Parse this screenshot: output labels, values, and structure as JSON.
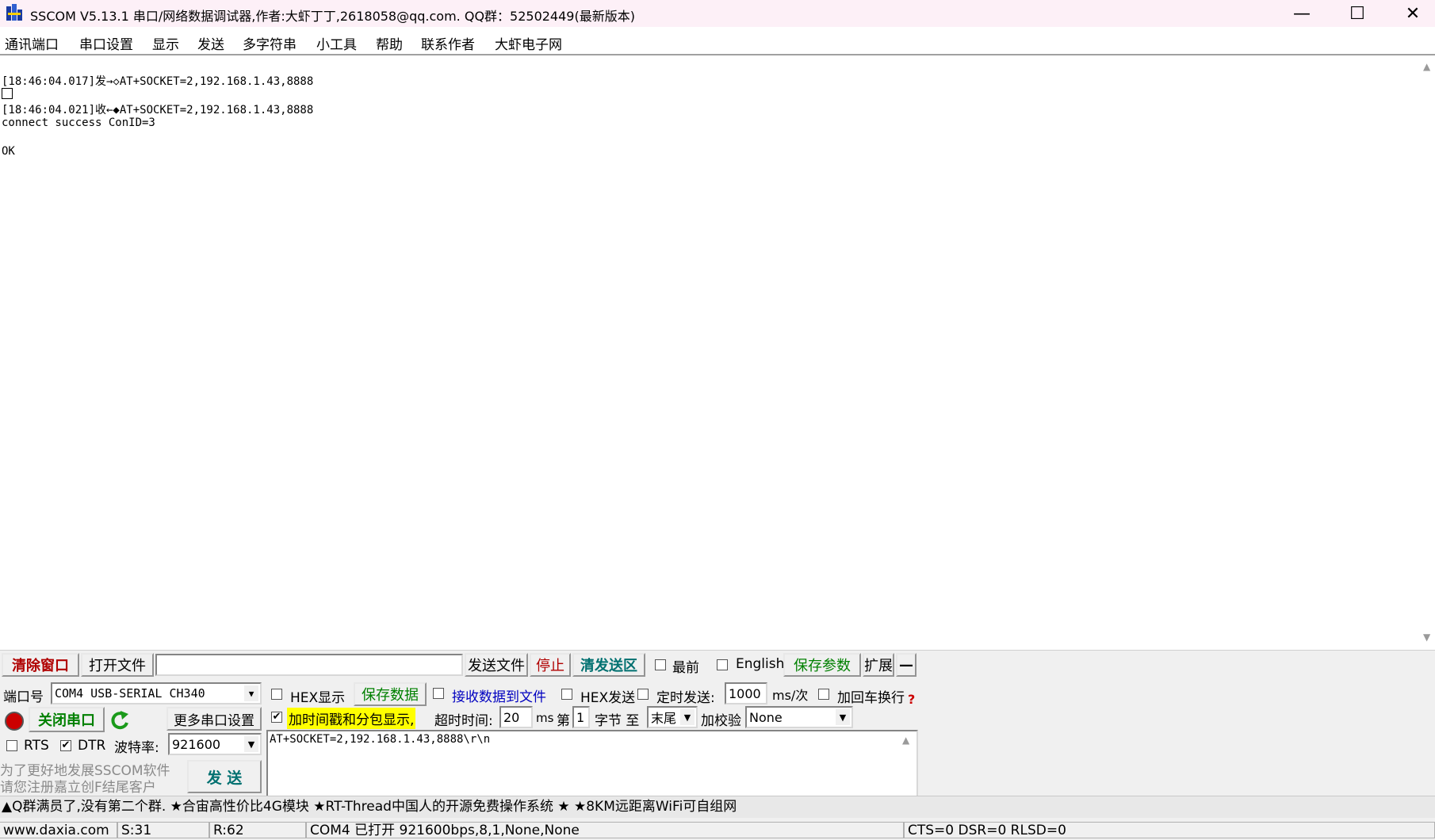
{
  "window": {
    "title": "SSCOM V5.13.1 串口/网络数据调试器,作者:大虾丁丁,2618058@qq.com. QQ群：52502449(最新版本)",
    "minimize": "—",
    "maximize": "☐",
    "close": "✕"
  },
  "menu": [
    "通讯端口",
    "串口设置",
    "显示",
    "发送",
    "多字符串",
    "小工具",
    "帮助",
    "联系作者",
    "大虾电子网"
  ],
  "log": {
    "line1": "[18:46:04.017]发→◇AT+SOCKET=2,192.168.1.43,8888",
    "line2": "[18:46:04.021]收←◆AT+SOCKET=2,192.168.1.43,8888",
    "line3": "connect success ConID=3",
    "line4": "OK"
  },
  "toolbar": {
    "clear_window": "清除窗口",
    "open_file": "打开文件",
    "file_path": "",
    "send_file": "发送文件",
    "stop": "停止",
    "clear_send": "清发送区",
    "topmost": "最前",
    "english": "English",
    "save_params": "保存参数",
    "expand": "扩展",
    "collapse": "—"
  },
  "port": {
    "port_label": "端口号",
    "port_value": "COM4 USB-SERIAL CH340",
    "close_port": "关闭串口",
    "more_settings": "更多串口设置",
    "rts": "RTS",
    "dtr": "DTR",
    "baud_label": "波特率:",
    "baud_value": "921600",
    "promo_line1": "为了更好地发展SSCOM软件",
    "promo_line2": "请您注册嘉立创F结尾客户",
    "send": "发 送"
  },
  "options": {
    "hex_display": "HEX显示",
    "save_data": "保存数据",
    "recv_to_file": "接收数据到文件",
    "hex_send": "HEX发送",
    "timed_send": "定时发送:",
    "interval": "1000",
    "interval_unit": "ms/次",
    "append_crlf": "加回车换行",
    "timestamp": "加时间戳和分包显示,",
    "timeout_label": "超时时间:",
    "timeout_value": "20",
    "timeout_unit": "ms",
    "nth_label": "第",
    "nth_value": "1",
    "byte_to": "字节 至",
    "end_value": "末尾",
    "checksum_label": "加校验",
    "checksum_value": "None",
    "help": "?"
  },
  "send_text": "AT+SOCKET=2,192.168.1.43,8888\\r\\n",
  "marquee": "▲Q群满员了,没有第二个群. ★合宙高性价比4G模块 ★RT-Thread中国人的开源免费操作系统 ★ ★8KM远距离WiFi可自组网",
  "status": {
    "site": "www.daxia.com",
    "sent": "S:31",
    "recv": "R:62",
    "port_state": "COM4 已打开  921600bps,8,1,None,None",
    "lines": "CTS=0 DSR=0 RLSD=0"
  },
  "colors": {
    "title_bg": "#fdf0f7",
    "red_text": "#b00000",
    "green_text": "#008000",
    "blue_text": "#0000c0",
    "highlight": "#ffff00"
  }
}
